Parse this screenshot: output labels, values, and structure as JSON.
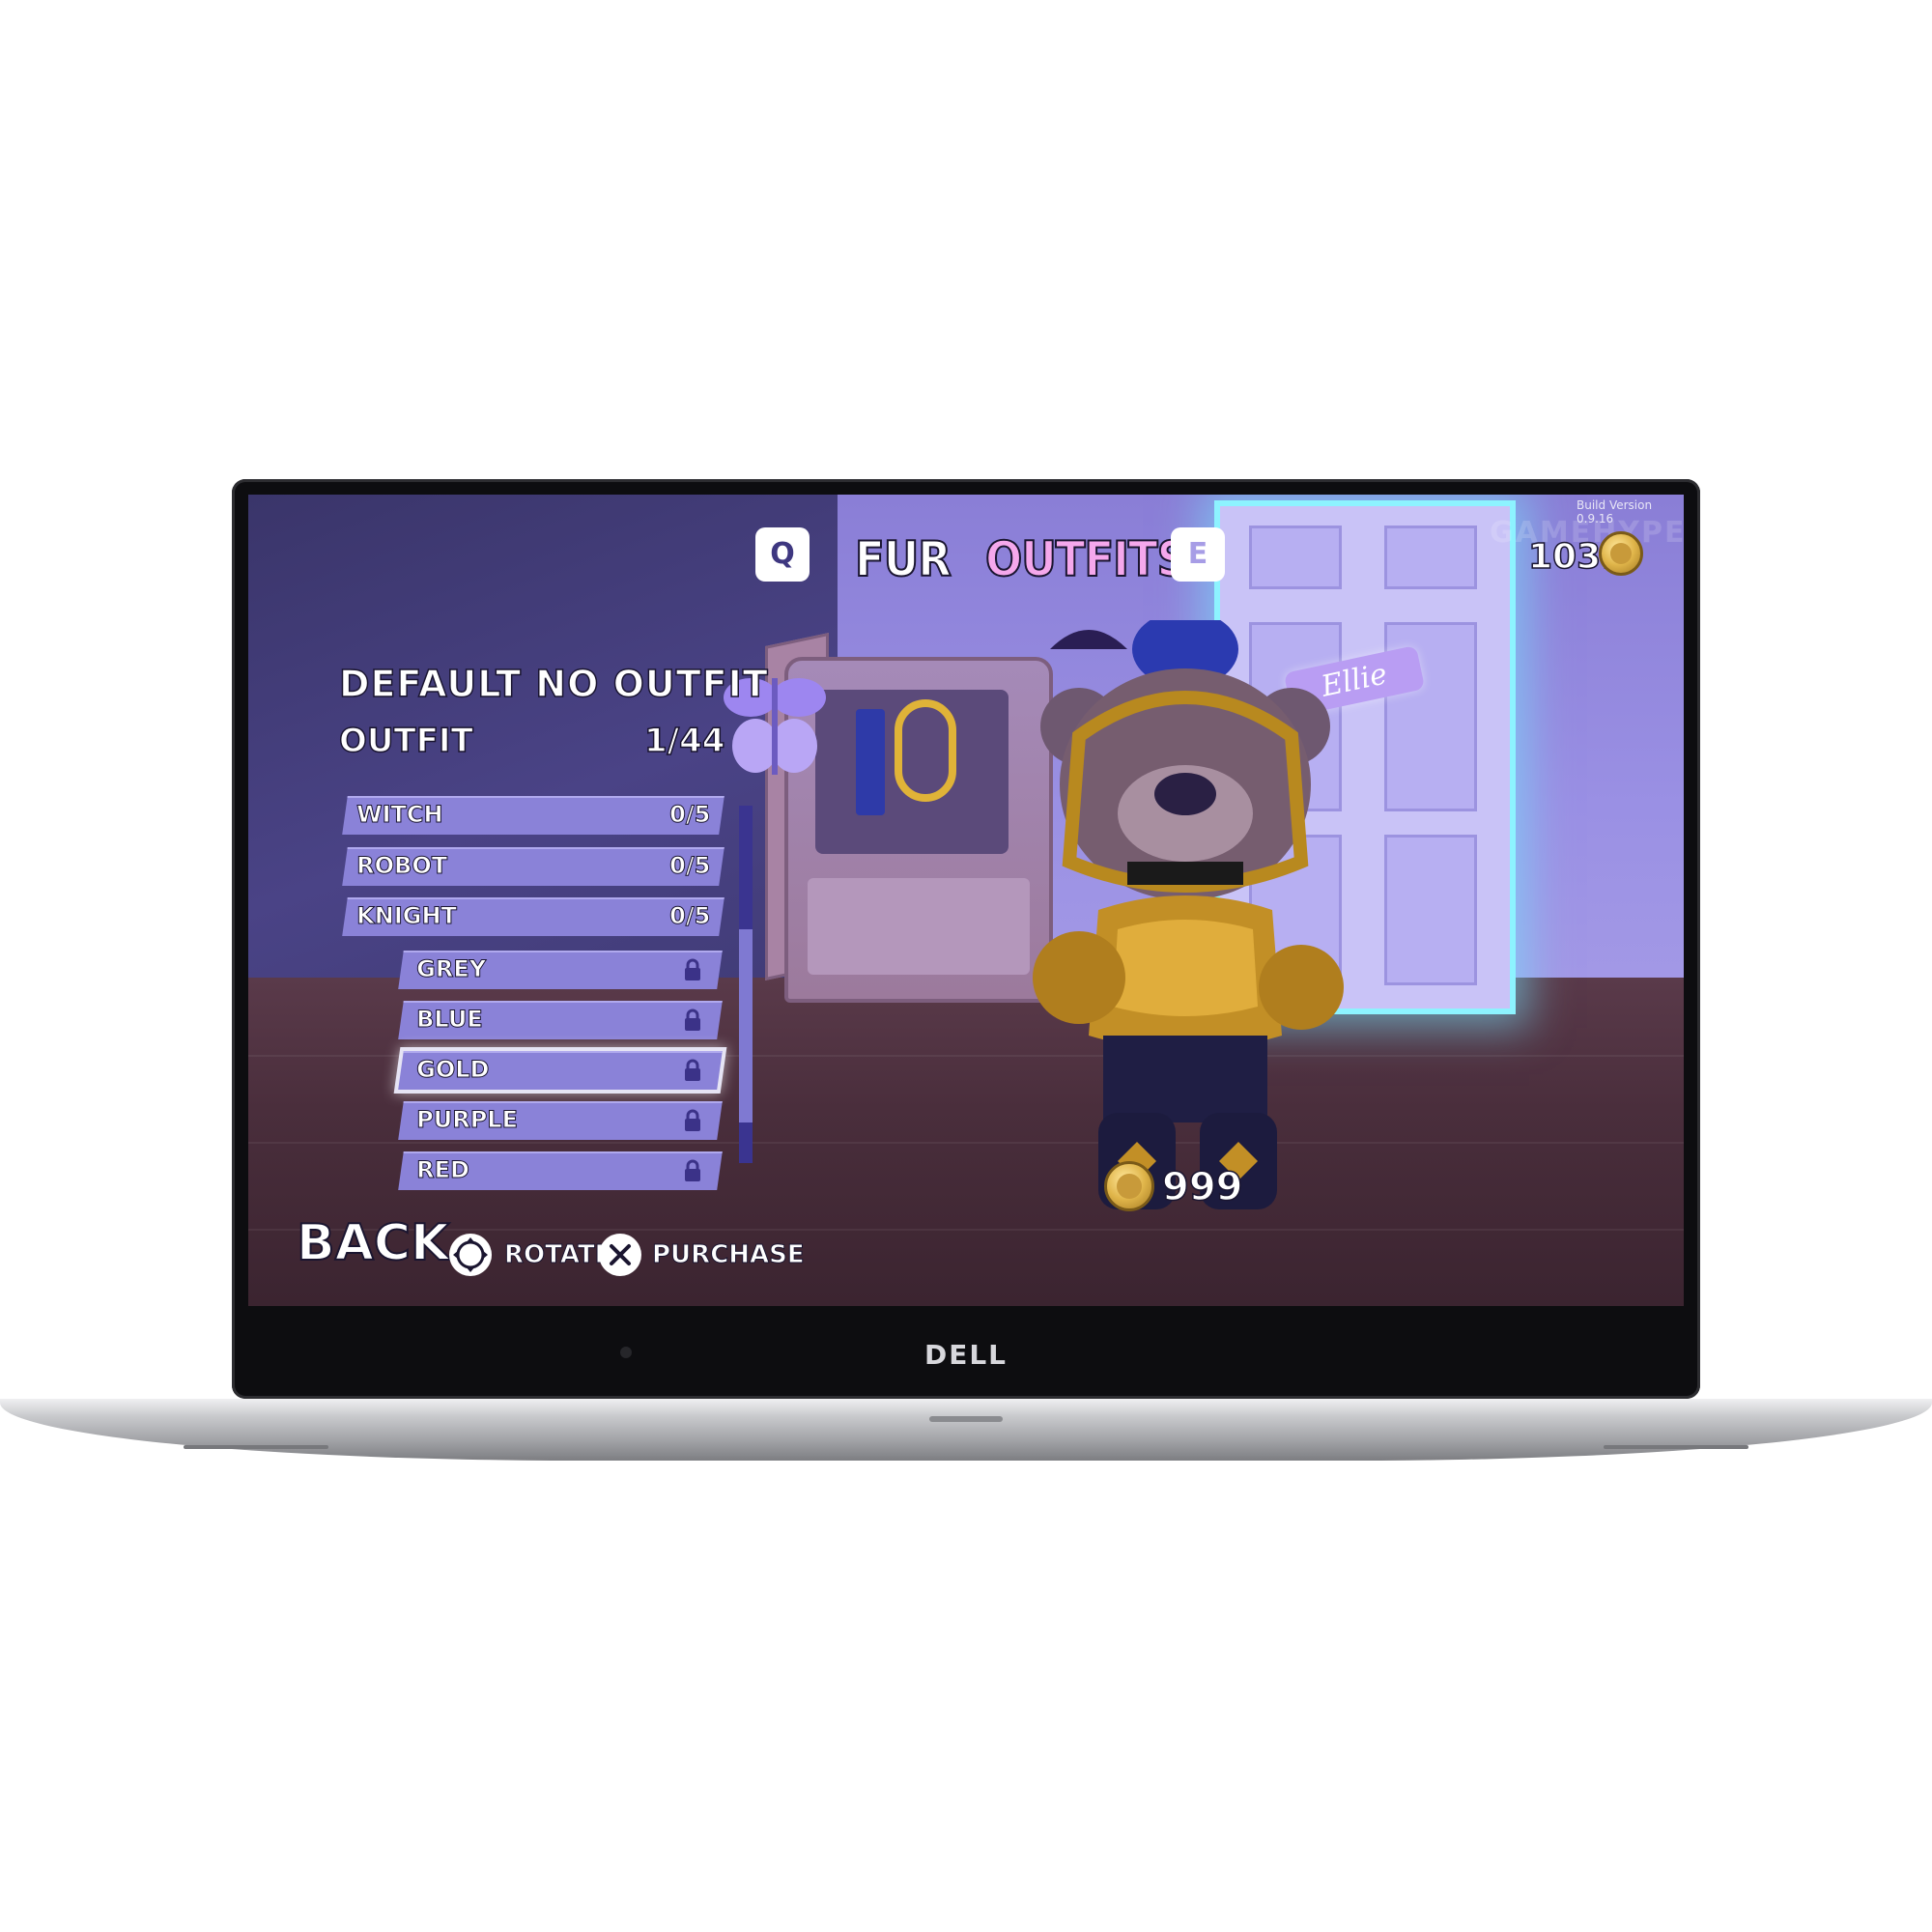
{
  "device": {
    "brand": "DELL"
  },
  "hud": {
    "build_version": "Build Version 0.9.16",
    "watermark": "GAMEHYPE",
    "currency": "1031",
    "tabs": {
      "prev_key": "Q",
      "fur": "FUR",
      "outfits": "OUTFITS",
      "next_key": "E"
    },
    "active_tab": "OUTFITS",
    "accent_color": "#f5a8ec"
  },
  "scene": {
    "sign_text": "Ellie"
  },
  "panel": {
    "title": "DEFAULT NO OUTFIT",
    "category_label": "OUTFIT",
    "category_count": "1/44",
    "items": [
      {
        "label": "WITCH",
        "count": "0/5",
        "type": "category"
      },
      {
        "label": "ROBOT",
        "count": "0/5",
        "type": "category"
      },
      {
        "label": "KNIGHT",
        "count": "0/5",
        "type": "category"
      },
      {
        "label": "GREY",
        "locked": true,
        "type": "variant"
      },
      {
        "label": "BLUE",
        "locked": true,
        "type": "variant"
      },
      {
        "label": "GOLD",
        "locked": true,
        "type": "variant",
        "selected": true
      },
      {
        "label": "PURPLE",
        "locked": true,
        "type": "variant"
      },
      {
        "label": "RED",
        "locked": true,
        "type": "variant"
      }
    ]
  },
  "price": "999",
  "footer": {
    "back": "BACK",
    "rotate": "ROTATE",
    "purchase": "PURCHASE"
  }
}
